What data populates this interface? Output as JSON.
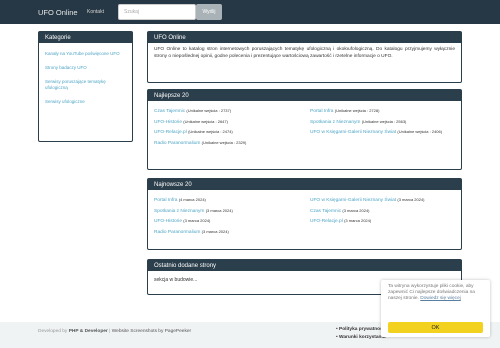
{
  "navbar": {
    "brand": "UFO Online",
    "contact": "Kontakt",
    "search_placeholder": "Szukaj",
    "search_button": "Wyślij"
  },
  "categories": {
    "title": "Kategorie",
    "items": [
      "Kanały na YouTube poświęcone UFO",
      "Strony badaczy UFO",
      "Serwisy poruszające tematykę ufologiczną",
      "Serwisy ufologiczne"
    ]
  },
  "about": {
    "title": "UFO Online",
    "text": "UFO Online to katalog stron internetowych poruszających tematykę ufologiczną i okołoufologiczną. Do katalogu przyjmujemy wyłącznie strony o niepoślednej opinii, godne polecenia i prezentujące wartościową zawartość i rzetelne informacje o UFO."
  },
  "best": {
    "title": "Najlepsze 20",
    "left": [
      {
        "name": "Czas Tajemnic",
        "note": "(Unikalne wejścia : 2737)"
      },
      {
        "name": "UFO-Historie",
        "note": "(Unikalne wejścia : 2647)"
      },
      {
        "name": "UFO-Relacje.pl",
        "note": "(Unikalne wejścia : 2474)"
      },
      {
        "name": "Radio Paranormalium",
        "note": "(Unikalne wejścia : 2329)"
      }
    ],
    "right": [
      {
        "name": "Portal Infra",
        "note": "(Unikalne wejścia : 2728)"
      },
      {
        "name": "Spotkania z Nieznanym",
        "note": "(Unikalne wejścia : 2563)"
      },
      {
        "name": "UFO w Księgarni-Galerii Nieznany Świat",
        "note": "(Unikalne wejścia : 2406)"
      }
    ]
  },
  "newest": {
    "title": "Najnowsze 20",
    "left": [
      {
        "name": "Portal Infra",
        "note": "(4 marca 2024)"
      },
      {
        "name": "Spotkania z Nieznanym",
        "note": "(3 marca 2024)"
      },
      {
        "name": "UFO-Historie",
        "note": "(3 marca 2024)"
      },
      {
        "name": "Radio Paranormalium",
        "note": "(3 marca 2024)"
      }
    ],
    "right": [
      {
        "name": "UFO w Księgarni-Galerii Nieznany Świat",
        "note": "(3 marca 2024)"
      },
      {
        "name": "Czas Tajemnic",
        "note": "(3 marca 2024)"
      },
      {
        "name": "UFO-Relacje.pl",
        "note": "(3 marca 2024)"
      }
    ]
  },
  "latest": {
    "title": "Ostatnio dodane strony",
    "text": "sekcja w budowie..."
  },
  "footer": {
    "developed_by": "Developed by",
    "dev_name": "PHP & Developer",
    "separator": "|",
    "screenshots": "Website Screenshots by PagePeeker",
    "links": [
      "Polityka prywatności",
      "Warunki korzystania"
    ]
  },
  "cookie": {
    "text": "Ta witryna wykorzystuje pliki cookie, aby zapewnić Ci najlepsze doświadczenia na naszej stronie.",
    "more": "Dowiedz się więcej",
    "ok": "OK"
  },
  "colors": {
    "navbar": "#263845",
    "panel_header": "#2b3e4c",
    "link": "#4ea5c6",
    "cookie_button": "#f2d21e"
  }
}
